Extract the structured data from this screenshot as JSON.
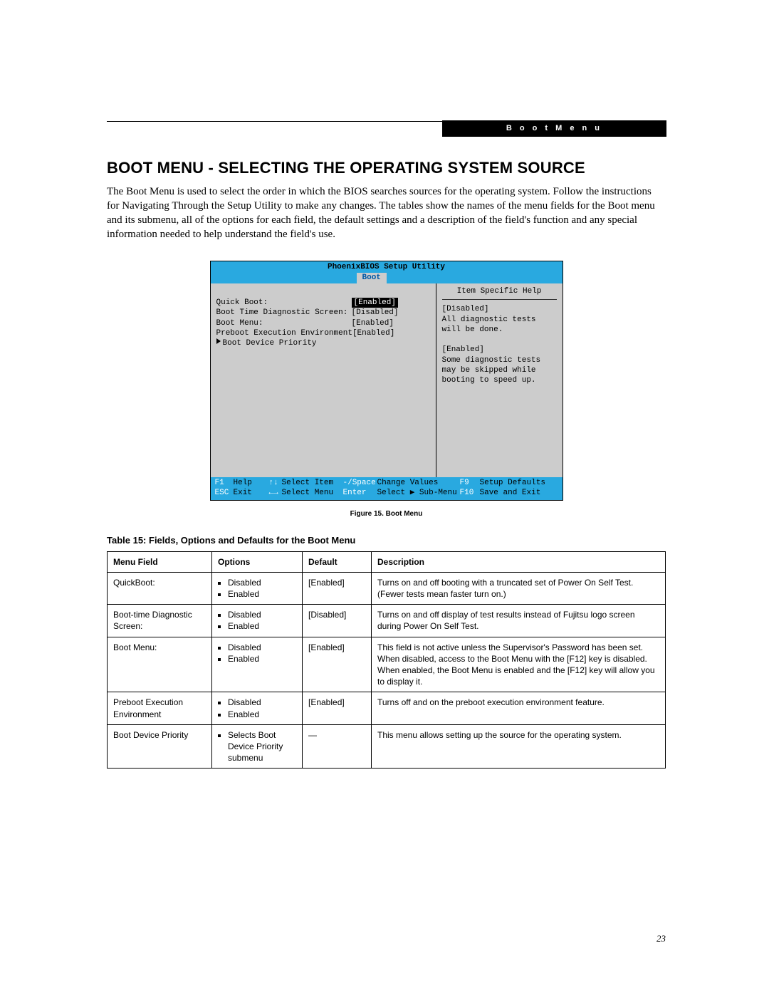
{
  "header_tab": "B o o t   M e n u",
  "title": "BOOT MENU - SELECTING THE OPERATING SYSTEM SOURCE",
  "intro": "The Boot Menu is used to select the order in which the BIOS searches sources for the operating system. Follow the instructions for Navigating Through the Setup Utility to make any changes. The tables show the names of the menu fields for the Boot menu and its submenu, all of the options for each field, the default settings and a description of the field's function and any special information needed to help understand the field's use.",
  "bios": {
    "title": "PhoenixBIOS Setup Utility",
    "active_tab": "Boot",
    "fields": [
      {
        "label": "Quick Boot:",
        "value": "[Enabled]",
        "selected": true
      },
      {
        "label": "Boot Time Diagnostic Screen:",
        "value": "[Disabled]",
        "selected": false
      },
      {
        "label": "Boot Menu:",
        "value": "[Enabled]",
        "selected": false
      },
      {
        "label": "Preboot Execution Environment",
        "value": "[Enabled]",
        "selected": false
      }
    ],
    "submenu_label": "Boot Device Priority",
    "help_title": "Item Specific Help",
    "help_body": "[Disabled]\nAll diagnostic tests will be done.\n\n[Enabled]\nSome diagnostic tests may be skipped while booting to speed up.",
    "footer": {
      "f1_key": "F1",
      "f1_label": "Help",
      "sel_item_arrows": "↑↓",
      "sel_item_label": "Select Item",
      "chg_key": "-/Space",
      "chg_label": "Change Values",
      "f9_key": "F9",
      "f9_label": "Setup Defaults",
      "esc_key": "ESC",
      "esc_label": "Exit",
      "sel_menu_arrows": "←→",
      "sel_menu_label": "Select Menu",
      "enter_key": "Enter",
      "enter_label": "Select ▶ Sub-Menu",
      "f10_key": "F10",
      "f10_label": "Save and Exit"
    }
  },
  "figure_caption": "Figure 15.   Boot Menu",
  "table_title": "Table 15: Fields, Options and Defaults for the Boot Menu",
  "table": {
    "headers": [
      "Menu Field",
      "Options",
      "Default",
      "Description"
    ],
    "rows": [
      {
        "field": "QuickBoot:",
        "options": [
          "Disabled",
          "Enabled"
        ],
        "default": "[Enabled]",
        "desc": "Turns on and off booting with a truncated set of Power On Self Test. (Fewer tests mean faster turn on.)"
      },
      {
        "field": "Boot-time Diagnostic Screen:",
        "options": [
          "Disabled",
          "Enabled"
        ],
        "default": "[Disabled]",
        "desc": "Turns on and off display of test results instead of Fujitsu logo screen during Power On Self Test."
      },
      {
        "field": "Boot Menu:",
        "options": [
          "Disabled",
          "Enabled"
        ],
        "default": "[Enabled]",
        "desc": "This field is not active unless the Supervisor's Password has been set. When disabled, access to the Boot Menu with the [F12] key is disabled. When enabled, the Boot Menu is enabled and the [F12] key will allow you to display it."
      },
      {
        "field": "Preboot Execution Environment",
        "options": [
          "Disabled",
          "Enabled"
        ],
        "default": "[Enabled]",
        "desc": "Turns off and on the preboot execution environment feature."
      },
      {
        "field": "Boot Device Priority",
        "options": [
          "Selects Boot Device Priority submenu"
        ],
        "default": "—",
        "desc": "This menu allows setting up the source for the operating system."
      }
    ]
  },
  "page_number": "23"
}
